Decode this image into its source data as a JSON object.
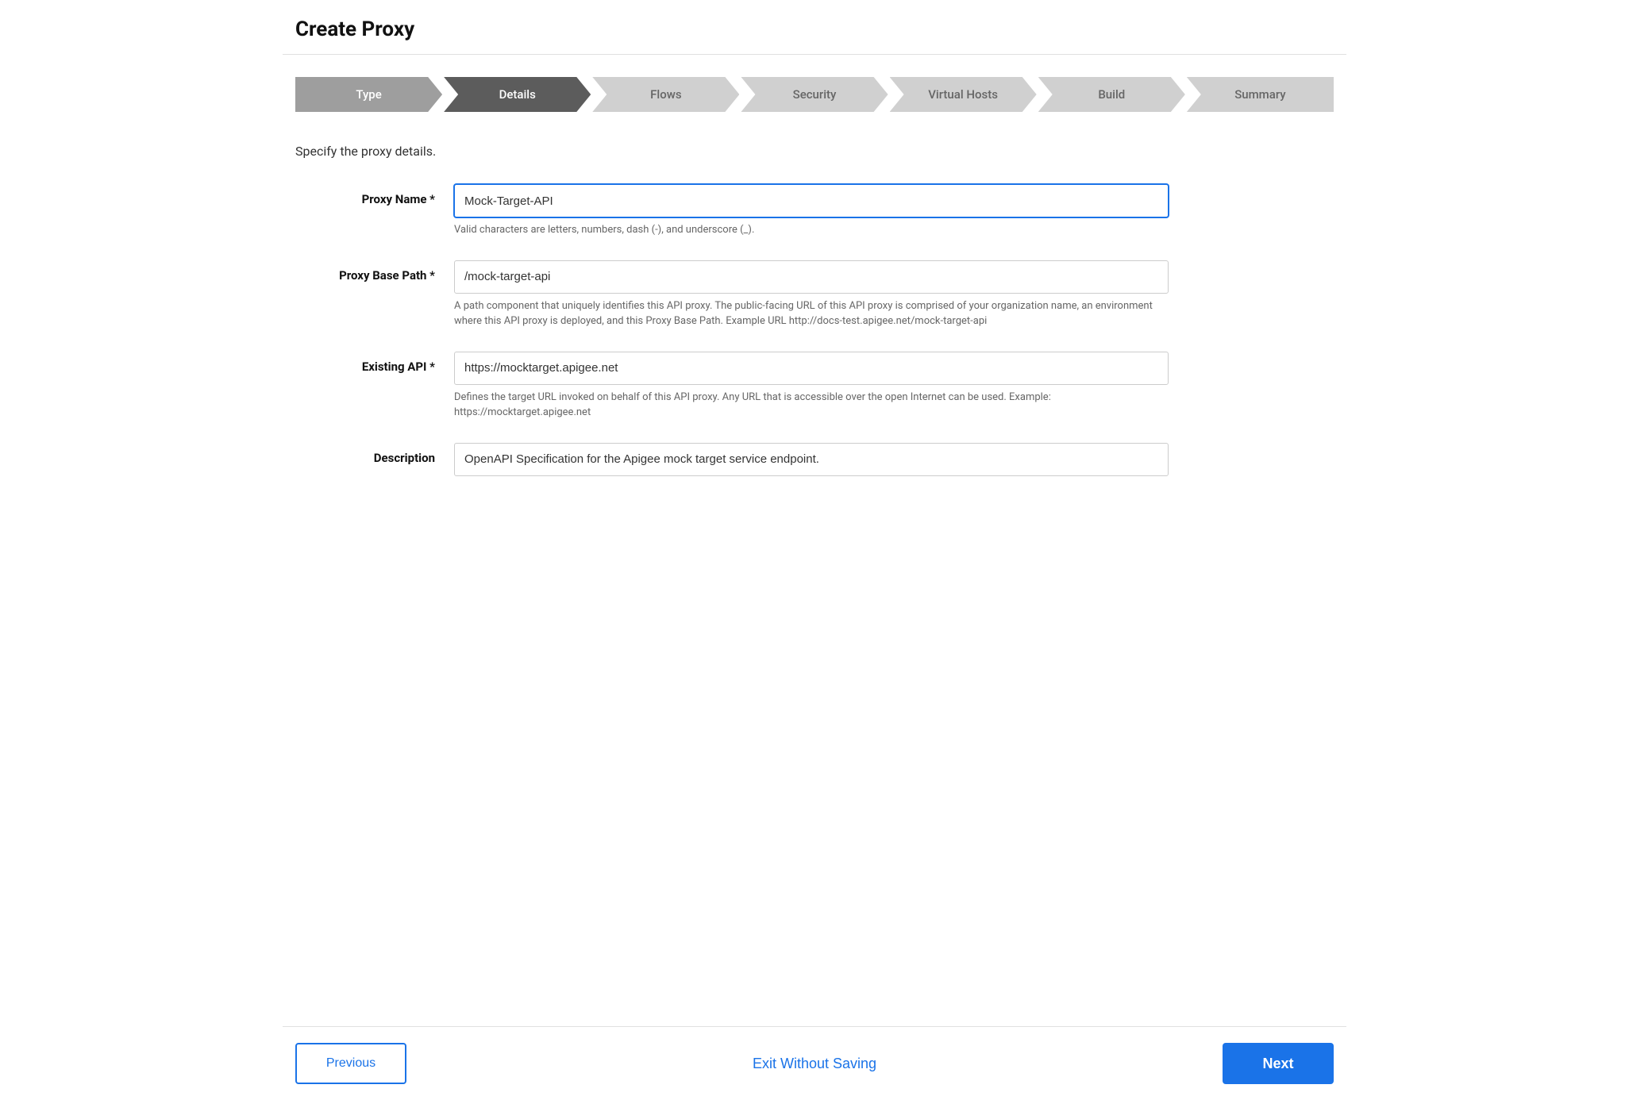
{
  "page": {
    "title": "Create Proxy"
  },
  "stepper": {
    "steps": [
      {
        "id": "type",
        "label": "Type",
        "state": "completed"
      },
      {
        "id": "details",
        "label": "Details",
        "state": "active"
      },
      {
        "id": "flows",
        "label": "Flows",
        "state": "inactive"
      },
      {
        "id": "security",
        "label": "Security",
        "state": "inactive"
      },
      {
        "id": "virtual-hosts",
        "label": "Virtual Hosts",
        "state": "inactive"
      },
      {
        "id": "build",
        "label": "Build",
        "state": "inactive"
      },
      {
        "id": "summary",
        "label": "Summary",
        "state": "inactive"
      }
    ]
  },
  "section": {
    "description": "Specify the proxy details."
  },
  "form": {
    "proxy_name": {
      "label": "Proxy Name",
      "required": true,
      "value": "Mock-Target-API",
      "hint": "Valid characters are letters, numbers, dash (-), and underscore (_)."
    },
    "proxy_base_path": {
      "label": "Proxy Base Path",
      "required": true,
      "value": "/mock-target-api",
      "hint": "A path component that uniquely identifies this API proxy. The public-facing URL of this API proxy is comprised of your organization name, an environment where this API proxy is deployed, and this Proxy Base Path. Example URL http://docs-test.apigee.net/mock-target-api"
    },
    "existing_api": {
      "label": "Existing API",
      "required": true,
      "value": "https://mocktarget.apigee.net",
      "hint": "Defines the target URL invoked on behalf of this API proxy. Any URL that is accessible over the open Internet can be used. Example: https://mocktarget.apigee.net"
    },
    "description": {
      "label": "Description",
      "required": false,
      "value": "OpenAPI Specification for the Apigee mock target service endpoint.",
      "hint": ""
    }
  },
  "footer": {
    "previous_label": "Previous",
    "exit_label": "Exit Without Saving",
    "next_label": "Next"
  }
}
